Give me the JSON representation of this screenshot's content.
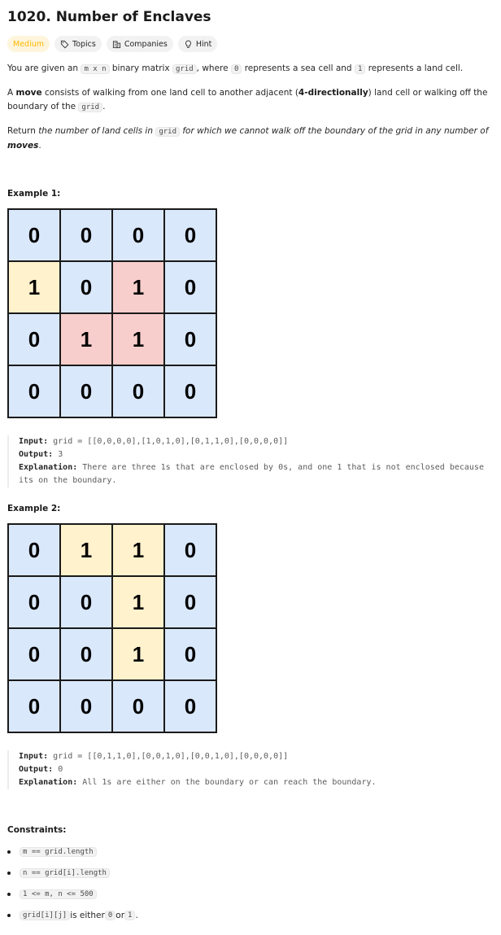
{
  "title": "1020. Number of Enclaves",
  "tags": {
    "difficulty": "Medium",
    "topics": "Topics",
    "companies": "Companies",
    "hint": "Hint"
  },
  "description": {
    "p1": [
      "You are given an ",
      "m x n",
      " binary matrix ",
      "grid",
      ", where ",
      "0",
      " represents a sea cell and ",
      "1",
      " represents a land cell."
    ],
    "p2": [
      "A ",
      "move",
      " consists of walking from one land cell to another adjacent (",
      "4-directionally",
      ") land cell or walking off the boundary of the ",
      "grid",
      "."
    ],
    "p3": [
      "Return ",
      "the number of land cells in ",
      "grid",
      " for which we cannot walk off the boundary of the grid in any number of ",
      "moves",
      "."
    ]
  },
  "examples": [
    {
      "title": "Example 1:",
      "grid": [
        [
          0,
          0,
          0,
          0
        ],
        [
          1,
          0,
          1,
          0
        ],
        [
          0,
          1,
          1,
          0
        ],
        [
          0,
          0,
          0,
          0
        ]
      ],
      "cell_types": [
        [
          "sea",
          "sea",
          "sea",
          "sea"
        ],
        [
          "land",
          "sea",
          "encl",
          "sea"
        ],
        [
          "sea",
          "encl",
          "encl",
          "sea"
        ],
        [
          "sea",
          "sea",
          "sea",
          "sea"
        ]
      ],
      "input_label": "Input:",
      "input": "grid = [[0,0,0,0],[1,0,1,0],[0,1,1,0],[0,0,0,0]]",
      "output_label": "Output:",
      "output": "3",
      "explanation_label": "Explanation:",
      "explanation": "There are three 1s that are enclosed by 0s, and one 1 that is not enclosed because its on the boundary."
    },
    {
      "title": "Example 2:",
      "grid": [
        [
          0,
          1,
          1,
          0
        ],
        [
          0,
          0,
          1,
          0
        ],
        [
          0,
          0,
          1,
          0
        ],
        [
          0,
          0,
          0,
          0
        ]
      ],
      "cell_types": [
        [
          "sea",
          "land",
          "land",
          "sea"
        ],
        [
          "sea",
          "sea",
          "land",
          "sea"
        ],
        [
          "sea",
          "sea",
          "land",
          "sea"
        ],
        [
          "sea",
          "sea",
          "sea",
          "sea"
        ]
      ],
      "input_label": "Input:",
      "input": "grid = [[0,1,1,0],[0,0,1,0],[0,0,1,0],[0,0,0,0]]",
      "output_label": "Output:",
      "output": "0",
      "explanation_label": "Explanation:",
      "explanation": "All 1s are either on the boundary or can reach the boundary."
    }
  ],
  "constraints": {
    "title": "Constraints:",
    "items": [
      {
        "code": "m == grid.length",
        "text": ""
      },
      {
        "code": "n == grid[i].length",
        "text": ""
      },
      {
        "code": "1 <= m, n <= 500",
        "text": ""
      },
      {
        "code": "grid[i][j]",
        "text": " is either ",
        "code2": "0",
        "text2": " or ",
        "code3": "1",
        "text3": "."
      }
    ]
  },
  "colors": {
    "sea": "#dae8fc",
    "land": "#fff2cc",
    "enclosed": "#f8cecc",
    "medium": "#ffb800"
  },
  "icons": {
    "topics": "tag-icon",
    "companies": "building-icon",
    "hint": "lightbulb-icon"
  }
}
